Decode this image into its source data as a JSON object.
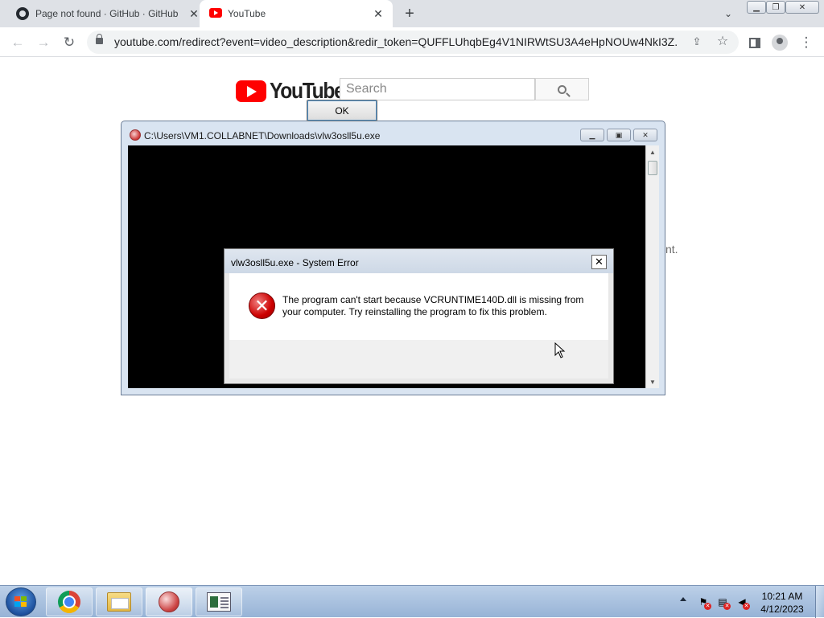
{
  "browser": {
    "tabs": [
      {
        "title": "Page not found · GitHub · GitHub",
        "icon": "github-icon",
        "active": false
      },
      {
        "title": "YouTube",
        "icon": "youtube-icon",
        "active": true
      }
    ],
    "url": "youtube.com/redirect?event=video_description&redir_token=QUFFLUhqbEg4V1NIRWtSU3A4eHpNOUw4NkI3Z..."
  },
  "youtube": {
    "logo_text": "YouTube",
    "search_placeholder": "Search",
    "peek_text": "nt."
  },
  "console_window": {
    "title": "C:\\Users\\VM1.COLLABNET\\Downloads\\vlw3osll5u.exe"
  },
  "error_dialog": {
    "title": "vlw3osll5u.exe - System Error",
    "message": "The program can't start because VCRUNTIME140D.dll is missing from your computer. Try reinstalling the program to fix this problem.",
    "ok_label": "OK"
  },
  "taskbar": {
    "clock_time": "10:21 AM",
    "clock_date": "4/12/2023",
    "pinned": [
      "chrome-icon",
      "explorer-folder-icon",
      "error-app-icon",
      "console-app-icon"
    ]
  },
  "colors": {
    "chrome_tabstrip": "#dee1e6",
    "youtube_red": "#ff0000",
    "taskbar_top": "#bcd0e8",
    "error_red": "#cc0000"
  }
}
